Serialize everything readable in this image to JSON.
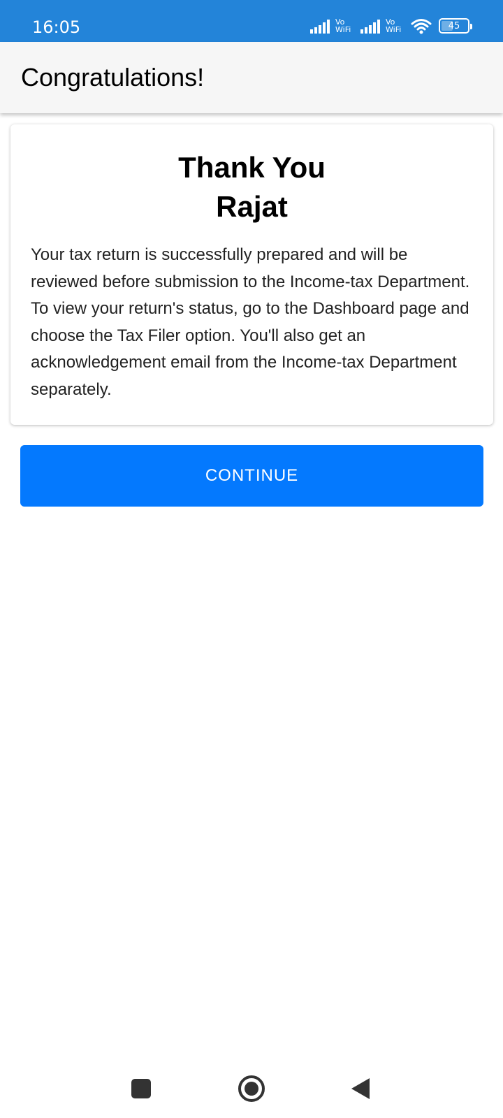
{
  "status_bar": {
    "time": "16:05",
    "network_label_top": "Vo",
    "network_label_bottom": "WiFi",
    "battery_level": "45",
    "icons": [
      "signal-icon",
      "vowifi-icon",
      "signal-icon",
      "vowifi-icon",
      "wifi-icon",
      "battery-icon"
    ]
  },
  "app_bar": {
    "title": "Congratulations!"
  },
  "card": {
    "heading_line1": "Thank You",
    "heading_line2": "Rajat",
    "body": "Your tax return is successfully prepared and will be reviewed before submission to the Income-tax Department. To view your return's status, go to the Dashboard page and choose the Tax Filer option. You'll also get an acknowledgement email from the Income-tax Department separately."
  },
  "actions": {
    "continue_label": "CONTINUE"
  },
  "nav_bar": {
    "icons": [
      "recents-icon",
      "home-icon",
      "back-icon"
    ]
  },
  "colors": {
    "status_bar": "#2384d9",
    "primary_button": "#0479fe",
    "app_bar": "#f6f6f6"
  }
}
